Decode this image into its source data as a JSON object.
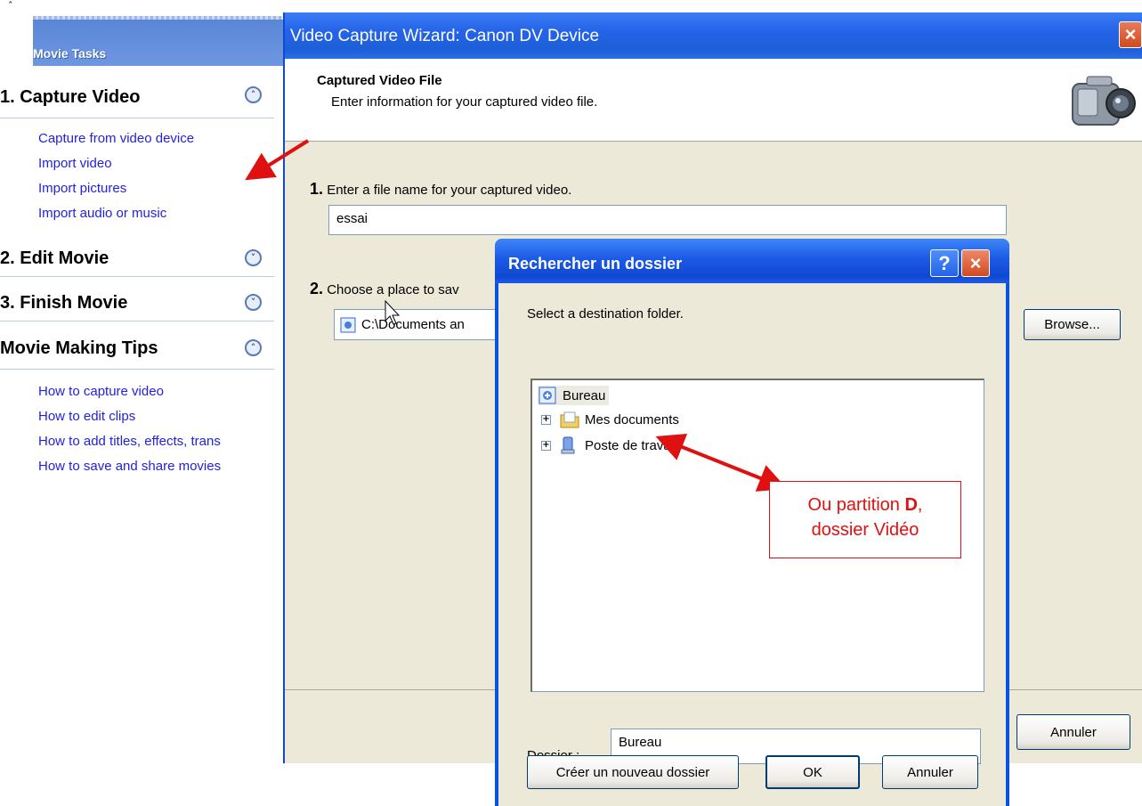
{
  "taskpane": {
    "corner_mark": "ˆ",
    "header": "Movie Tasks",
    "sections": [
      {
        "title": "1. Capture Video",
        "toggle": "collapse",
        "links": [
          "Capture from video device",
          "Import video",
          "Import pictures",
          "Import audio or music"
        ]
      },
      {
        "title": "2. Edit Movie",
        "toggle": "expand",
        "links": []
      },
      {
        "title": "3. Finish Movie",
        "toggle": "expand",
        "links": []
      },
      {
        "title": "Movie Making Tips",
        "toggle": "collapse",
        "links": [
          "How to capture video",
          "How to edit clips",
          "How to add titles, effects, trans",
          "How to save and share movies"
        ]
      }
    ]
  },
  "wizard": {
    "title": "Video Capture Wizard: Canon DV Device",
    "close_label": "×",
    "header_title": "Captured Video File",
    "header_subtitle": "Enter information for your captured video file.",
    "step1_num": "1.",
    "step1_label": "Enter a file name for your captured video.",
    "filename_value": "essai",
    "step2_num": "2.",
    "step2_label": "Choose a place to sav",
    "location_value": "C:\\Documents an",
    "browse_label": "Browse...",
    "cancel_label": "Annuler",
    "icon": "camcorder-icon"
  },
  "dialog": {
    "title": "Rechercher un dossier",
    "help_label": "?",
    "close_label": "×",
    "instruction": "Select a destination folder.",
    "tree": [
      {
        "label": "Bureau",
        "icon": "desktop-icon",
        "expander": ""
      },
      {
        "label": "Mes documents",
        "icon": "folder-icon",
        "expander": "+"
      },
      {
        "label": "Poste de travail",
        "icon": "computer-icon",
        "expander": "+"
      }
    ],
    "folder_label": "Dossier :",
    "folder_value": "Bureau",
    "new_folder_label": "Créer un nouveau dossier",
    "ok_label": "OK",
    "cancel_label": "Annuler"
  },
  "annotation": {
    "line1_prefix": "Ou partition ",
    "line1_bold": "D",
    "line1_suffix": ",",
    "line2": "dossier Vidéo",
    "arrow_color": "#e01010"
  }
}
